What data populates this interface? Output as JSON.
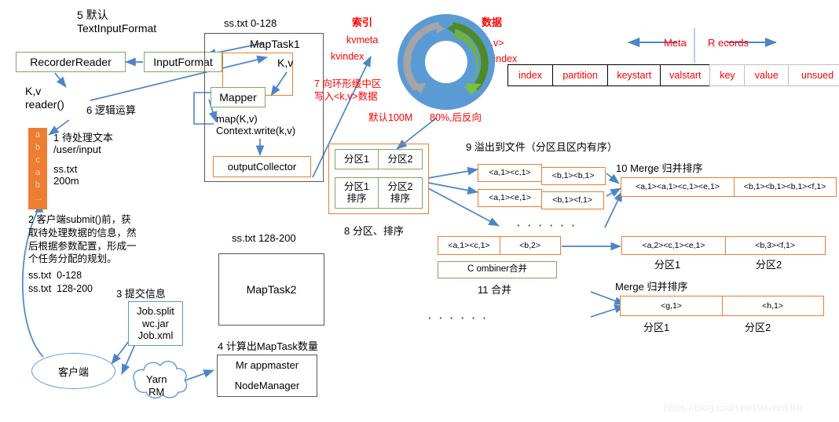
{
  "watermark": "https://blog.csdn.net/wuxintdrh",
  "labels": {
    "step5": "5 默认\nTextInputFormat",
    "sstxt_0_128": "ss.txt 0-128",
    "maptask1": "MapTask1",
    "recorderreader": "RecorderReader",
    "inputformat": "InputFormat",
    "kv_right": "K,v",
    "mapper": "Mapper",
    "kv_reader": "K,v\nreader()",
    "step6": "6 逻辑运算",
    "map_context": "map(K,v)\nContext.write(k,v)",
    "outputcollector": "outputCollector",
    "step1": "1 待处理文本\n/user/input",
    "sstxt_200m": "ss.txt\n200m",
    "step2": "2 客户端submit()前，获\n取待处理数据的信息，然\n后根据参数配置，形成一\n个任务分配的规划。",
    "step2_split1": "ss.txt  0-128",
    "step2_split2": "ss.txt  128-200",
    "step3": "3 提交信息",
    "jobsplit": "Job.split\nwc.jar\nJob.xml",
    "client": "客户端",
    "yarn": "Yarn\nRM",
    "step4": "4 计算出MapTask数量",
    "appmaster": "Mr appmaster",
    "nodemanager": "NodeManager",
    "sstxt_128_200": "ss.txt 128-200",
    "maptask2": "MapTask2",
    "index_cn": "索引",
    "kvmeta": "kvmeta",
    "kvindex": "kvindex",
    "data_cn": "数据",
    "kv_angle": "<k,v>",
    "bufindex": "bufindex",
    "step7": "7 向环形缓中区\n写入<k,v>数据",
    "default100m": "默认100M",
    "percent80": "80%,后反向",
    "meta": "Meta",
    "records": "R ecords",
    "step8": "8 分区、排序",
    "step9": "9 溢出到文件（分区且区内有序）",
    "step10": "10 Merge 归并排序",
    "step11": "11 合并",
    "combiner": "C ombiner合并",
    "merge_sort": "Merge 归并排序",
    "partition1": "分区1",
    "partition2": "分区2",
    "partition1_sort": "分区1\n排序",
    "partition2_sort": "分区2\n排序",
    "dots_row": "· · ·    · · ·",
    "dots_row2": "· · ·    · · ·"
  },
  "meta_table": {
    "meta_cells": [
      "index",
      "partition",
      "keystart",
      "valstart"
    ],
    "record_cells": [
      "key",
      "value",
      "unsued"
    ]
  },
  "spill": {
    "file1": [
      "<a,1><c,1>",
      "<b,1><b,1>"
    ],
    "file2": [
      "<a,1><e,1>",
      "<b,1><f,1>"
    ],
    "combine_src": [
      "<a,1><c,1>",
      "<b,2>"
    ],
    "merge1": [
      "<a,1><a,1><c,1><e,1>",
      "<b,1><b,1><b,1><f,1>"
    ],
    "merge2": [
      "<a,2><c,1><e,1>",
      "<b,3><f,1>"
    ],
    "merge3": [
      "<g,1>",
      "<h,1>"
    ]
  },
  "vcolumn": {
    "letters": [
      "a",
      "b",
      "c",
      "a",
      "b",
      "..."
    ]
  },
  "colors": {
    "green": "#7aab59",
    "orange": "#ed7d31",
    "blue": "#5b9bd5",
    "gray": "#a5a5a5",
    "dark": "#595959",
    "red": "#ff0000"
  }
}
